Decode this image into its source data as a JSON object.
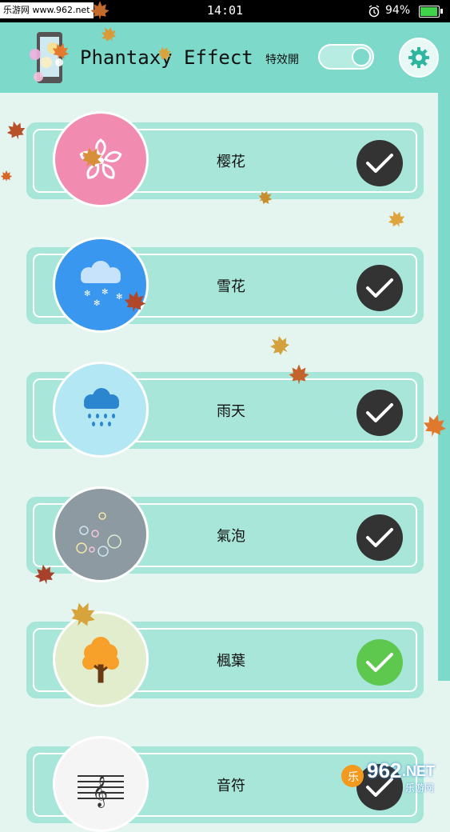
{
  "status_bar": {
    "watermark": "乐游网 www.962.net",
    "time": "14:01",
    "battery": "94%"
  },
  "header": {
    "title": "Phantaxy Effect",
    "toggle_label": "特效開",
    "toggle_on": true
  },
  "effects": [
    {
      "label": "樱花",
      "icon": "cherry-blossom-icon",
      "bg": "#f28bb0",
      "checked": true,
      "check_color": "#333333"
    },
    {
      "label": "雪花",
      "icon": "snow-cloud-icon",
      "bg": "#3a97f0",
      "checked": true,
      "check_color": "#333333"
    },
    {
      "label": "雨天",
      "icon": "rain-cloud-icon",
      "bg": "#b3e7f3",
      "checked": true,
      "check_color": "#333333"
    },
    {
      "label": "氣泡",
      "icon": "bubbles-icon",
      "bg": "#8d9aa1",
      "checked": true,
      "check_color": "#333333"
    },
    {
      "label": "楓葉",
      "icon": "maple-tree-icon",
      "bg": "#e1edcd",
      "checked": true,
      "check_color": "#5ec84e"
    },
    {
      "label": "音符",
      "icon": "music-staff-icon",
      "bg": "#f5f5f5",
      "checked": true,
      "check_color": "#333333"
    }
  ],
  "corner_watermark": {
    "brand": "962",
    "suffix": ".NET",
    "caption": "乐游网"
  }
}
